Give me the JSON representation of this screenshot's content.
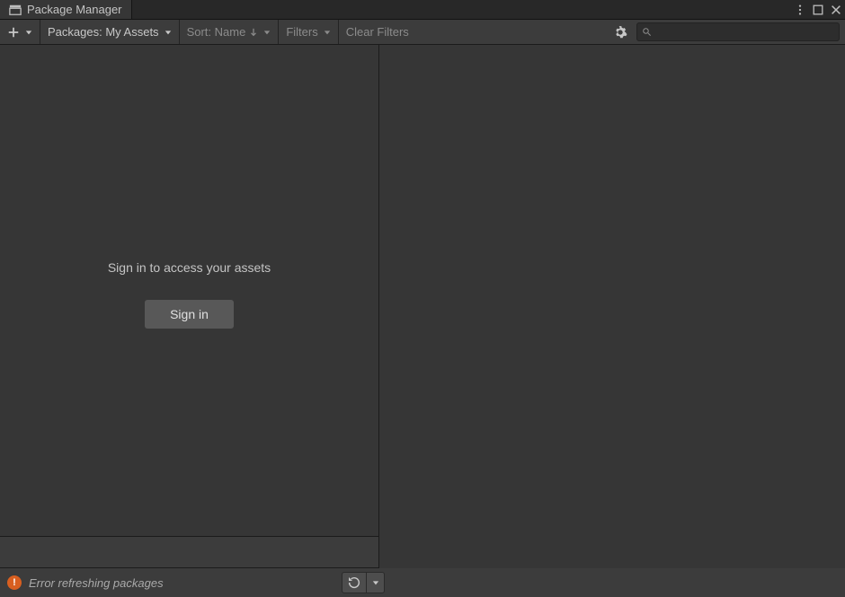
{
  "titlebar": {
    "title": "Package Manager"
  },
  "toolbar": {
    "packages_scope": "Packages: My Assets",
    "sort_label": "Sort: Name",
    "filters_label": "Filters",
    "clear_filters_label": "Clear Filters",
    "search_placeholder": ""
  },
  "left_panel": {
    "prompt": "Sign in to access your assets",
    "signin_label": "Sign in"
  },
  "status": {
    "message": "Error refreshing packages"
  },
  "colors": {
    "error_badge": "#d85f20"
  }
}
